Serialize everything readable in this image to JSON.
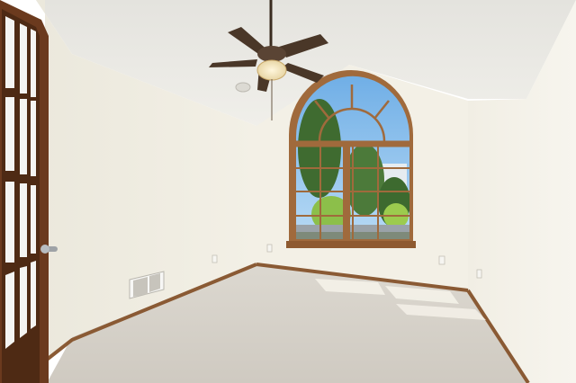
{
  "scene": {
    "subject": "empty-bedroom",
    "palette": {
      "ceiling": "#ecebe6",
      "wall_light": "#f4f1e8",
      "wall_shadow": "#e8e5da",
      "carpet": "#d8d4cc",
      "trim_wood": "#8a5a34",
      "door_wood": "#6b3a1e",
      "sky": "#8fc3ee",
      "tree_green": "#4c7a3a",
      "fan_blade": "#4a3728",
      "light_glow": "#f3e6c4"
    }
  }
}
